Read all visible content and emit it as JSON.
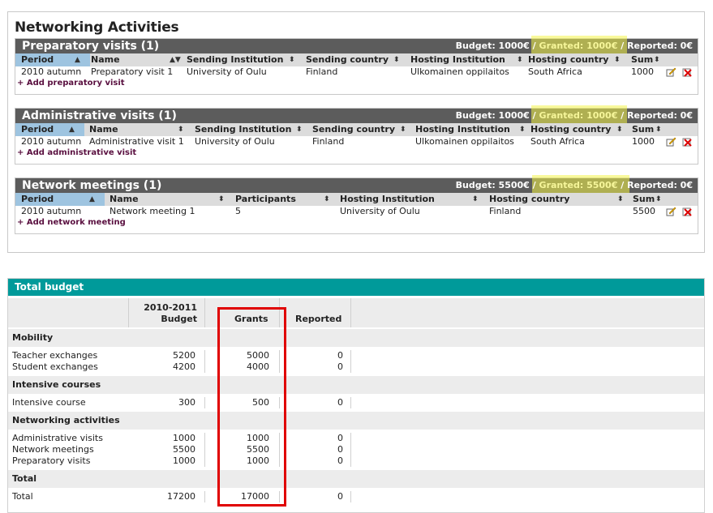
{
  "page_title": "Networking Activities",
  "sections": {
    "preparatory": {
      "title": "Preparatory visits (1)",
      "budget": "Budget: 1000€",
      "granted": "Granted: 1000€",
      "reported": "Reported: 0€",
      "sep": "/",
      "headers": [
        "Period",
        "Name",
        "Sending Institution",
        "Sending country",
        "Hosting Institution",
        "Hosting country",
        "Sum"
      ],
      "row": [
        "2010 autumn",
        "Preparatory visit 1",
        "University of Oulu",
        "Finland",
        "Ulkomainen oppilaitos",
        "South Africa",
        "1000"
      ],
      "add": "+ Add preparatory visit"
    },
    "administrative": {
      "title": "Administrative visits (1)",
      "budget": "Budget: 1000€",
      "granted": "Granted: 1000€",
      "reported": "Reported: 0€",
      "sep": "/",
      "headers": [
        "Period",
        "Name",
        "Sending Institution",
        "Sending country",
        "Hosting Institution",
        "Hosting country",
        "Sum"
      ],
      "row": [
        "2010 autumn",
        "Administrative visit 1",
        "University of Oulu",
        "Finland",
        "Ulkomainen oppilaitos",
        "South Africa",
        "1000"
      ],
      "add": "+ Add administrative visit"
    },
    "meetings": {
      "title": "Network meetings (1)",
      "budget": "Budget: 5500€",
      "granted": "Granted: 5500€",
      "reported": "Reported: 0€",
      "sep": "/",
      "headers": [
        "Period",
        "Name",
        "Participants",
        "Hosting Institution",
        "Hosting country",
        "Sum"
      ],
      "row": [
        "2010 autumn",
        "Network meeting 1",
        "5",
        "University of Oulu",
        "Finland",
        "5500"
      ],
      "add": "+ Add network meeting"
    }
  },
  "total_budget": {
    "title": "Total budget",
    "col_budget_line1": "2010-2011",
    "col_budget_line2": "Budget",
    "col_grants": "Grants",
    "col_reported": "Reported",
    "groups": [
      {
        "name": "Mobility",
        "rows": [
          {
            "label": "Teacher exchanges",
            "budget": "5200",
            "grants": "5000",
            "reported": "0"
          },
          {
            "label": "Student exchanges",
            "budget": "4200",
            "grants": "4000",
            "reported": "0"
          }
        ]
      },
      {
        "name": "Intensive courses",
        "rows": [
          {
            "label": "Intensive course",
            "budget": "300",
            "grants": "500",
            "reported": "0"
          }
        ]
      },
      {
        "name": "Networking activities",
        "rows": [
          {
            "label": "Administrative visits",
            "budget": "1000",
            "grants": "1000",
            "reported": "0"
          },
          {
            "label": "Network meetings",
            "budget": "5500",
            "grants": "5500",
            "reported": "0"
          },
          {
            "label": "Preparatory visits",
            "budget": "1000",
            "grants": "1000",
            "reported": "0"
          }
        ]
      },
      {
        "name": "Total",
        "rows": [
          {
            "label": "Total",
            "budget": "17200",
            "grants": "17000",
            "reported": "0"
          }
        ]
      }
    ]
  },
  "colors": {
    "section_header": "#5c5c5c",
    "granted_highlight": "#f4f44a",
    "sorted_column": "#9ec4e0",
    "budget_header": "#009a9a",
    "annotation_box": "#e00000",
    "add_link": "#5a1040"
  }
}
